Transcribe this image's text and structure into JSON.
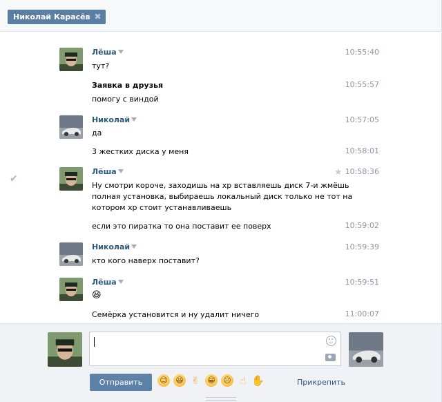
{
  "tab": {
    "name": "Николай Карасёв",
    "close": "✖"
  },
  "messages": [
    {
      "author": "Лёша",
      "time": "10:55:40",
      "text": "тут?"
    },
    {
      "time": "10:55:57",
      "text": "Заявка в друзья"
    },
    {
      "time": "",
      "text": "помогу с виндой"
    },
    {
      "author": "Николай",
      "time": "10:57:05",
      "text": "да"
    },
    {
      "time": "10:58:01",
      "text": "3 жестких диска у меня"
    },
    {
      "author": "Лёша",
      "time": "10:58:36",
      "line1": "Ну смотри короче, заходишь на хр вставляешь диск 7-и жмёшь",
      "line2": "полная установка, выбираешь локальный диск только не тот на",
      "line3": "котором хр стоит устанавливаешь"
    },
    {
      "time": "10:59:02",
      "text": "если это пиратка то она поставит ее поверх"
    },
    {
      "author": "Николай",
      "time": "10:59:39",
      "text": "кто кого наверх поставит?"
    },
    {
      "author": "Лёша",
      "time": "10:59:51",
      "text": "😆"
    },
    {
      "time": "11:00:07",
      "text": "Семёрка установится и ну удалит ничего"
    }
  ],
  "composer": {
    "send_label": "Отправить",
    "attach_label": "Прикрепить",
    "emojis": [
      "😊",
      "😆",
      "✌",
      "😁",
      "😐",
      "☝",
      "✋"
    ]
  },
  "icons": {
    "read_check": "check-icon",
    "favorite": "star-icon"
  }
}
